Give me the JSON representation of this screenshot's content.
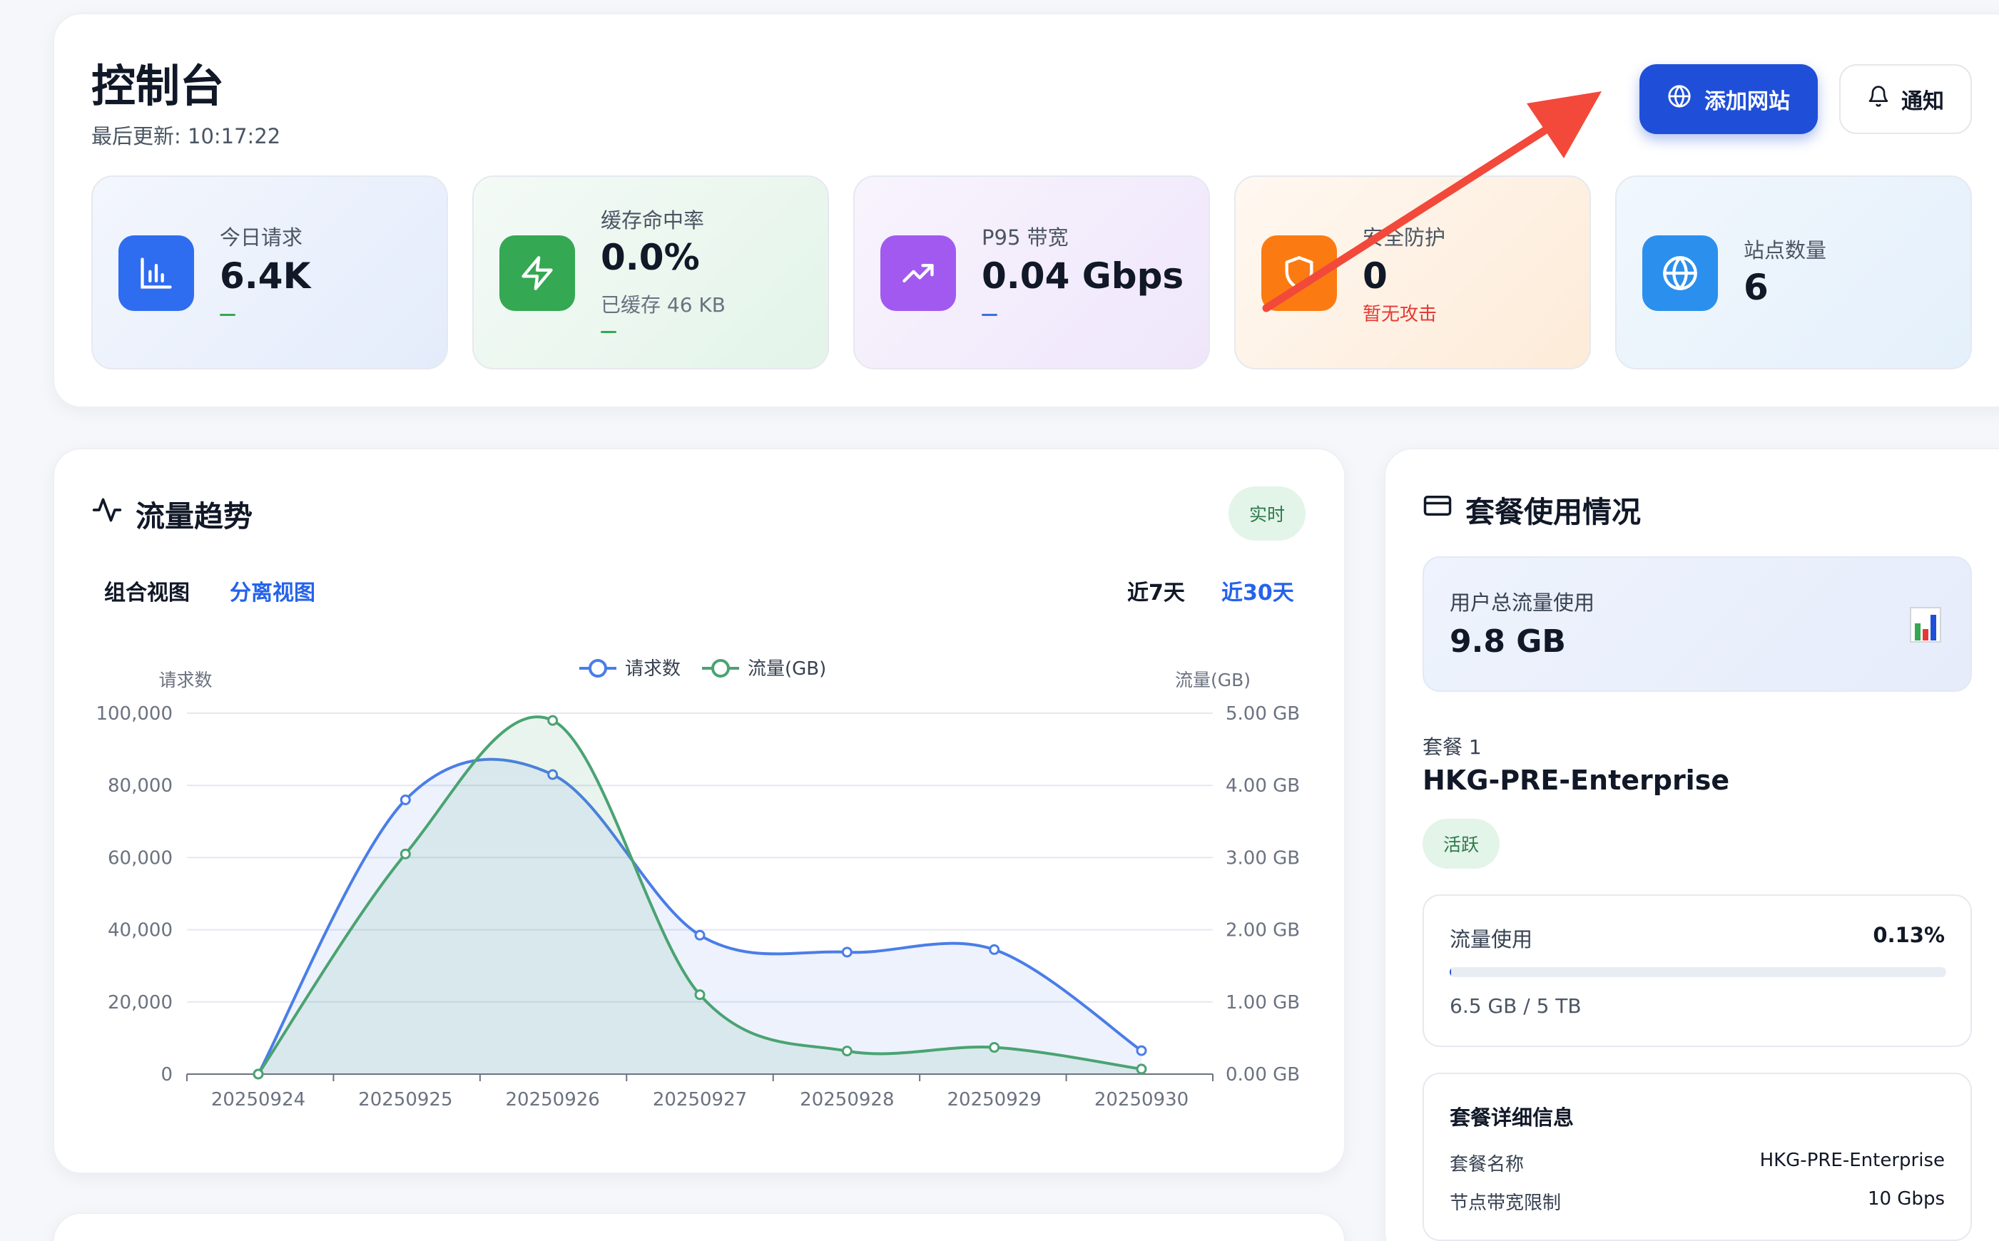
{
  "header": {
    "title": "控制台",
    "last_update": "最后更新: 10:17:22",
    "add_site_label": "添加网站",
    "notify_label": "通知"
  },
  "stats": [
    {
      "label": "今日请求",
      "value": "6.4K",
      "sub": "",
      "icon": "bar-chart-icon",
      "color": "#2f6df0",
      "dash_color": "#34a853"
    },
    {
      "label": "缓存命中率",
      "value": "0.0%",
      "sub": "已缓存 46 KB",
      "icon": "lightning-icon",
      "color": "#34a853",
      "dash_color": "#34a853"
    },
    {
      "label": "P95 带宽",
      "value": "0.04 Gbps",
      "sub": "",
      "icon": "trending-up-icon",
      "color": "#a259f0",
      "dash_color": "#3b6fe0"
    },
    {
      "label": "安全防护",
      "value": "0",
      "sub": "暂无攻击",
      "icon": "shield-icon",
      "color": "#fb7b12",
      "sub_color": "#e53935"
    },
    {
      "label": "站点数量",
      "value": "6",
      "sub": "",
      "icon": "globe-icon",
      "color": "#2b8fed"
    }
  ],
  "traffic": {
    "title": "流量趋势",
    "badge": "实时",
    "view_tabs": [
      "组合视图",
      "分离视图"
    ],
    "range_tabs": [
      "近7天",
      "近30天"
    ]
  },
  "chart_data": {
    "type": "line",
    "x": [
      "20250924",
      "20250925",
      "20250926",
      "20250927",
      "20250928",
      "20250929",
      "20250930"
    ],
    "series": [
      {
        "name": "请求数",
        "axis": "left",
        "color": "#4a7de8",
        "values": [
          0,
          76000,
          83000,
          38500,
          33800,
          34500,
          6500
        ]
      },
      {
        "name": "流量(GB)",
        "axis": "right",
        "color": "#4aa372",
        "values": [
          0,
          3.05,
          4.9,
          1.1,
          0.32,
          0.37,
          0.07
        ]
      }
    ],
    "ylabel_left": "请求数",
    "ylabel_right": "流量(GB)",
    "ylim_left": [
      0,
      100000
    ],
    "ylim_right": [
      0,
      5
    ],
    "yticks_left": [
      "100,000",
      "80,000",
      "60,000",
      "40,000",
      "20,000",
      "0"
    ],
    "yticks_right": [
      "5.00 GB",
      "4.00 GB",
      "3.00 GB",
      "2.00 GB",
      "1.00 GB",
      "0.00 GB"
    ],
    "legend": "top-center",
    "grid": true
  },
  "plan": {
    "title": "套餐使用情况",
    "total_label": "用户总流量使用",
    "total_value": "9.8 GB",
    "plan_index": "套餐 1",
    "plan_name": "HKG-PRE-Enterprise",
    "status": "活跃",
    "usage_label": "流量使用",
    "usage_percent": "0.13%",
    "usage_fraction": 0.0013,
    "usage_detail": "6.5 GB / 5 TB",
    "details_title": "套餐详细信息",
    "details": [
      {
        "key": "套餐名称",
        "value": "HKG-PRE-Enterprise"
      },
      {
        "key": "节点带宽限制",
        "value": "10 Gbps"
      }
    ]
  }
}
